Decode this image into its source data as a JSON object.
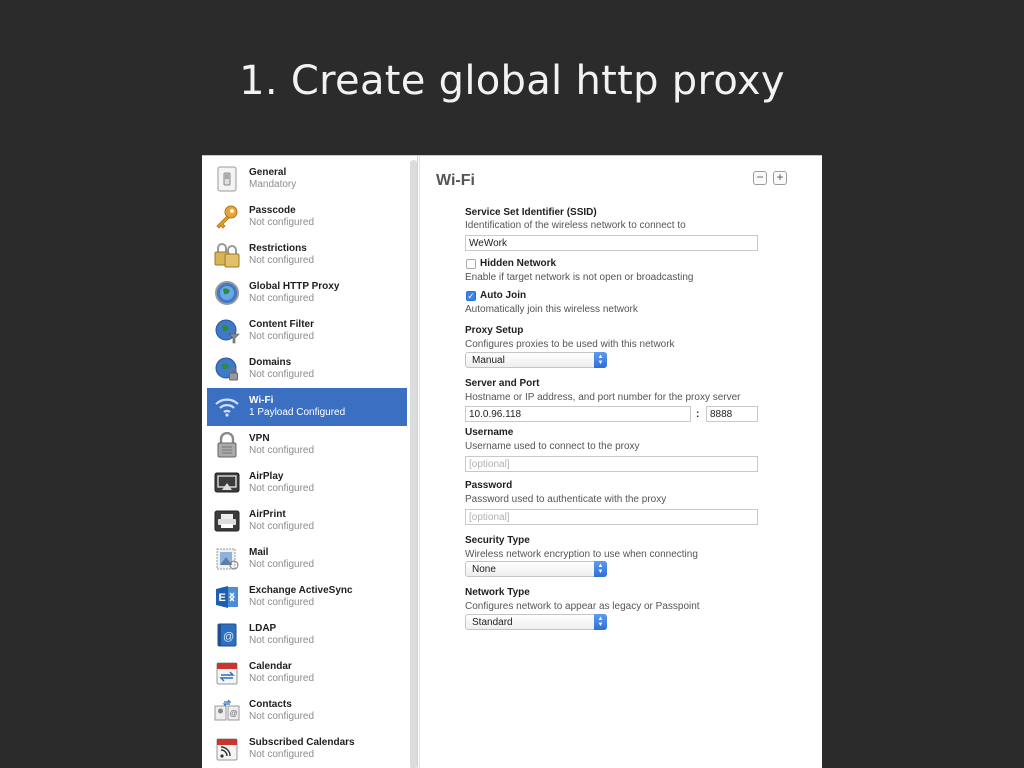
{
  "slide": {
    "title": "1. Create global http proxy"
  },
  "sidebar": {
    "items": [
      {
        "title": "General",
        "subtitle": "Mandatory",
        "icon": "general-switch-icon"
      },
      {
        "title": "Passcode",
        "subtitle": "Not configured",
        "icon": "key-icon"
      },
      {
        "title": "Restrictions",
        "subtitle": "Not configured",
        "icon": "padlocks-icon"
      },
      {
        "title": "Global HTTP Proxy",
        "subtitle": "Not configured",
        "icon": "globe-icon"
      },
      {
        "title": "Content Filter",
        "subtitle": "Not configured",
        "icon": "globe-filter-icon"
      },
      {
        "title": "Domains",
        "subtitle": "Not configured",
        "icon": "globe-lock-icon"
      },
      {
        "title": "Wi-Fi",
        "subtitle": "1 Payload Configured",
        "icon": "wifi-icon",
        "selected": true
      },
      {
        "title": "VPN",
        "subtitle": "Not configured",
        "icon": "vpn-lock-icon"
      },
      {
        "title": "AirPlay",
        "subtitle": "Not configured",
        "icon": "airplay-icon"
      },
      {
        "title": "AirPrint",
        "subtitle": "Not configured",
        "icon": "printer-icon"
      },
      {
        "title": "Mail",
        "subtitle": "Not configured",
        "icon": "mail-stamp-icon"
      },
      {
        "title": "Exchange ActiveSync",
        "subtitle": "Not configured",
        "icon": "exchange-icon"
      },
      {
        "title": "LDAP",
        "subtitle": "Not configured",
        "icon": "ldap-book-icon"
      },
      {
        "title": "Calendar",
        "subtitle": "Not configured",
        "icon": "calendar-icon"
      },
      {
        "title": "Contacts",
        "subtitle": "Not configured",
        "icon": "contacts-icon"
      },
      {
        "title": "Subscribed Calendars",
        "subtitle": "Not configured",
        "icon": "subscribed-calendar-icon"
      }
    ]
  },
  "main": {
    "title": "Wi-Fi",
    "remove_label": "−",
    "add_label": "+",
    "ssid": {
      "label": "Service Set Identifier (SSID)",
      "desc": "Identification of the wireless network to connect to",
      "value": "WeWork"
    },
    "hidden_network": {
      "label": "Hidden Network",
      "desc": "Enable if target network is not open or broadcasting",
      "checked": false
    },
    "auto_join": {
      "label": "Auto Join",
      "desc": "Automatically join this wireless network",
      "checked": true
    },
    "proxy_setup": {
      "label": "Proxy Setup",
      "desc": "Configures proxies to be used with this network",
      "value": "Manual"
    },
    "server_port": {
      "label": "Server and Port",
      "desc": "Hostname or IP address, and port number for the proxy server",
      "server": "10.0.96.118",
      "separator": ":",
      "port": "8888"
    },
    "username": {
      "label": "Username",
      "desc": "Username used to connect to the proxy",
      "placeholder": "[optional]"
    },
    "password": {
      "label": "Password",
      "desc": "Password used to authenticate with the proxy",
      "placeholder": "[optional]"
    },
    "security_type": {
      "label": "Security Type",
      "desc": "Wireless network encryption to use when connecting",
      "value": "None"
    },
    "network_type": {
      "label": "Network Type",
      "desc": "Configures network to appear as legacy or Passpoint",
      "value": "Standard"
    }
  },
  "colors": {
    "background": "#2b2b2b",
    "selection": "#3b6fc2",
    "accent": "#3b82e8"
  }
}
